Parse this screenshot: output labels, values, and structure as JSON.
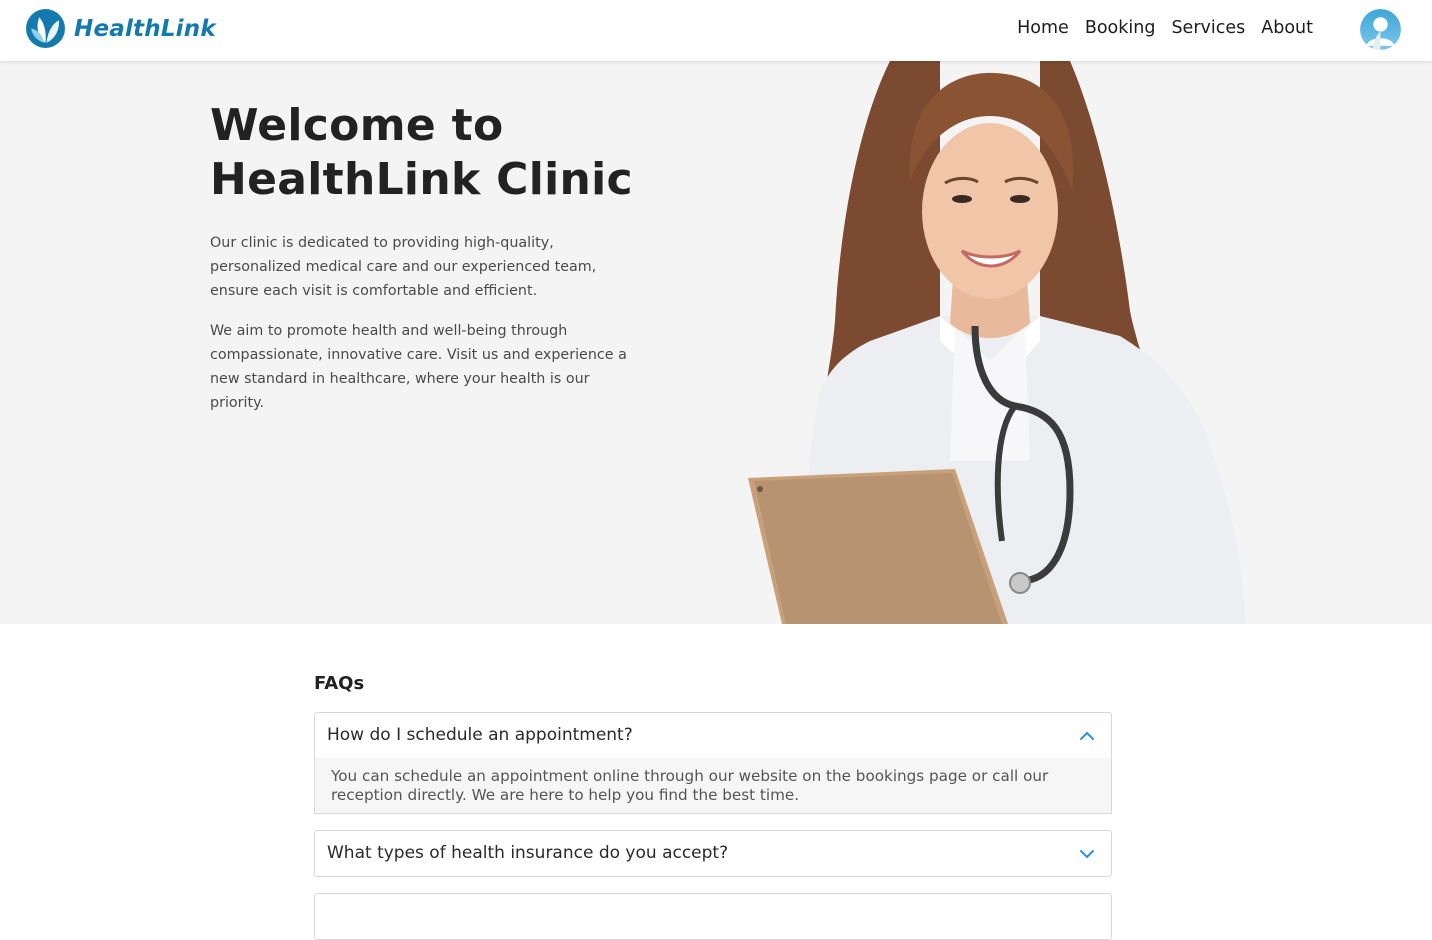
{
  "header": {
    "brand": "HealthLink",
    "nav": [
      "Home",
      "Booking",
      "Services",
      "About"
    ],
    "avatar_icon": "user-avatar-icon",
    "brand_color": "#1479ad"
  },
  "hero": {
    "title_line1": "Welcome to",
    "title_line2": "HealthLink Clinic",
    "paragraph1": "Our clinic is dedicated to providing high-quality, personalized medical care and our experienced team, ensure each visit is comfortable and efficient.",
    "paragraph2": "We aim to promote health and well-being through compassionate, innovative care. Visit us and experience a new standard in healthcare, where your health is our priority.",
    "image": "doctor-photo"
  },
  "faq": {
    "heading": "FAQs",
    "items": [
      {
        "question": "How do I schedule an appointment?",
        "answer": "You can schedule an appointment online through our website on the bookings page or call our reception directly. We are here to help you find the best time.",
        "expanded": true
      },
      {
        "question": "What types of health insurance do you accept?",
        "expanded": false
      }
    ],
    "accent_color": "#2f8fd8"
  }
}
